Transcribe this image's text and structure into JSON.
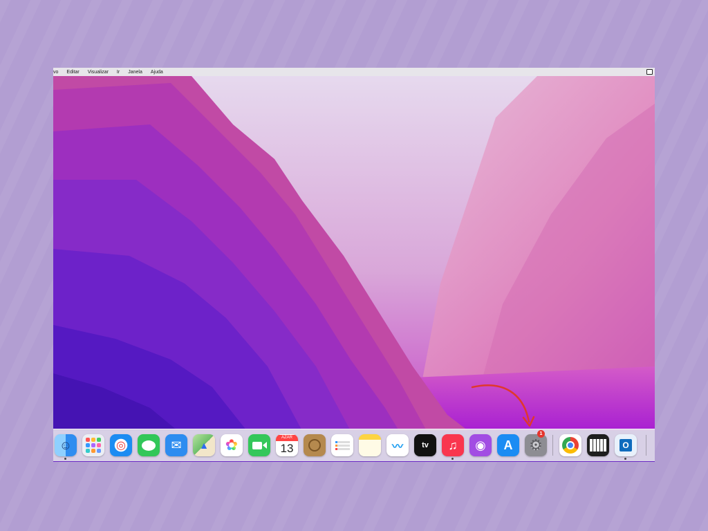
{
  "menubar": {
    "items": [
      "vo",
      "Editar",
      "Visualizar",
      "Ir",
      "Janela",
      "Ajuda"
    ]
  },
  "dock": {
    "apps": [
      {
        "name": "Finder",
        "icon": "finder-icon",
        "color": "#3d9df5",
        "glyph": "☺"
      },
      {
        "name": "Launchpad",
        "icon": "launchpad-icon",
        "color": "#eceff4",
        "glyph": ""
      },
      {
        "name": "Safari",
        "icon": "safari-icon",
        "color": "#1c8cf2",
        "glyph": "◎"
      },
      {
        "name": "Mensagens",
        "icon": "messages-icon",
        "color": "#32c759",
        "glyph": "💬"
      },
      {
        "name": "Mail",
        "icon": "mail-icon",
        "color": "#2d8cf0",
        "glyph": "✉"
      },
      {
        "name": "Mapas",
        "icon": "maps-icon",
        "color": "#7cc46a",
        "glyph": "▲"
      },
      {
        "name": "Fotos",
        "icon": "photos-icon",
        "color": "#ffffff",
        "glyph": "✿"
      },
      {
        "name": "FaceTime",
        "icon": "facetime-icon",
        "color": "#34c75a",
        "glyph": "■"
      },
      {
        "name": "Calendário",
        "icon": "calendar-icon",
        "color": "#ffffff",
        "month": "AZAR",
        "day": "13"
      },
      {
        "name": "Contatos",
        "icon": "contacts-icon",
        "color": "#b5894e",
        "glyph": "◉"
      },
      {
        "name": "Lembretes",
        "icon": "reminders-icon",
        "color": "#ffffff",
        "glyph": "☰"
      },
      {
        "name": "Notas",
        "icon": "notes-icon",
        "color": "#fff3b3",
        "glyph": ""
      },
      {
        "name": "Freeform",
        "icon": "freeform-icon",
        "color": "#ffffff",
        "glyph": "〰"
      },
      {
        "name": "Apple TV",
        "icon": "apple-tv-icon",
        "color": "#111111",
        "glyph": "tv"
      },
      {
        "name": "Música",
        "icon": "music-icon",
        "color": "#f9364e",
        "glyph": "♫"
      },
      {
        "name": "Podcasts",
        "icon": "podcasts-icon",
        "color": "#a24de3",
        "glyph": "◉"
      },
      {
        "name": "App Store",
        "icon": "app-store-icon",
        "color": "#1b8cf3",
        "glyph": "A"
      },
      {
        "name": "Ajustes do Sistema",
        "icon": "gear-icon",
        "color": "#8d8d93",
        "glyph": "⚙"
      },
      {
        "name": "Google Chrome",
        "icon": "chrome-icon",
        "color": "#ffffff",
        "glyph": ""
      },
      {
        "name": "Piano",
        "icon": "piano-icon",
        "color": "#1e1e1e",
        "glyph": ""
      },
      {
        "name": "Outlook",
        "icon": "outlook-icon",
        "color": "#0f6cbd",
        "glyph": "O"
      }
    ],
    "settings_badge": "1"
  },
  "colors": {
    "page_background": "#b29ed2",
    "annotation_arrow": "#e0382c"
  }
}
